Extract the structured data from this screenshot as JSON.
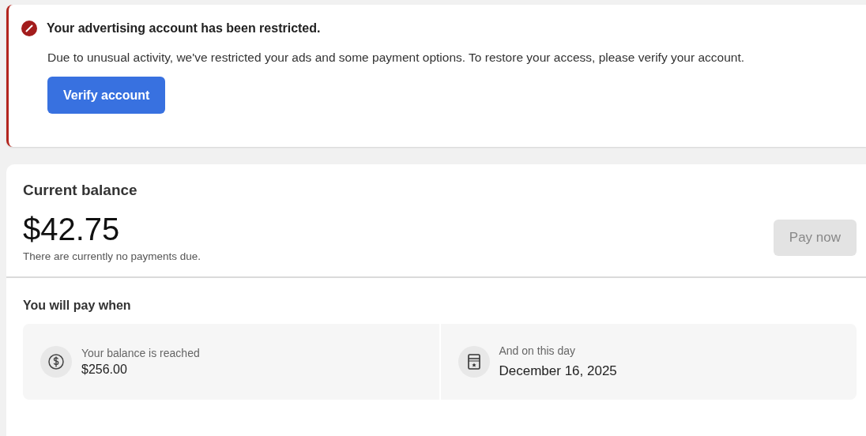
{
  "alert": {
    "title": "Your advertising account has been restricted.",
    "message": "Due to unusual activity, we've restricted your ads and some payment options. To restore your access, please verify your account.",
    "action": "Verify account"
  },
  "balance": {
    "title": "Current balance",
    "amount": "$42.75",
    "note": "There are currently no payments due.",
    "pay_button": {
      "label": "Pay now",
      "disabled": true
    }
  },
  "pay_when": {
    "title": "You will pay when",
    "conditions": [
      {
        "kind": "balance",
        "label": "Your balance is reached",
        "value": "$256.00"
      },
      {
        "kind": "date",
        "label": "And on this day",
        "value": "December 16, 2025"
      }
    ]
  }
}
